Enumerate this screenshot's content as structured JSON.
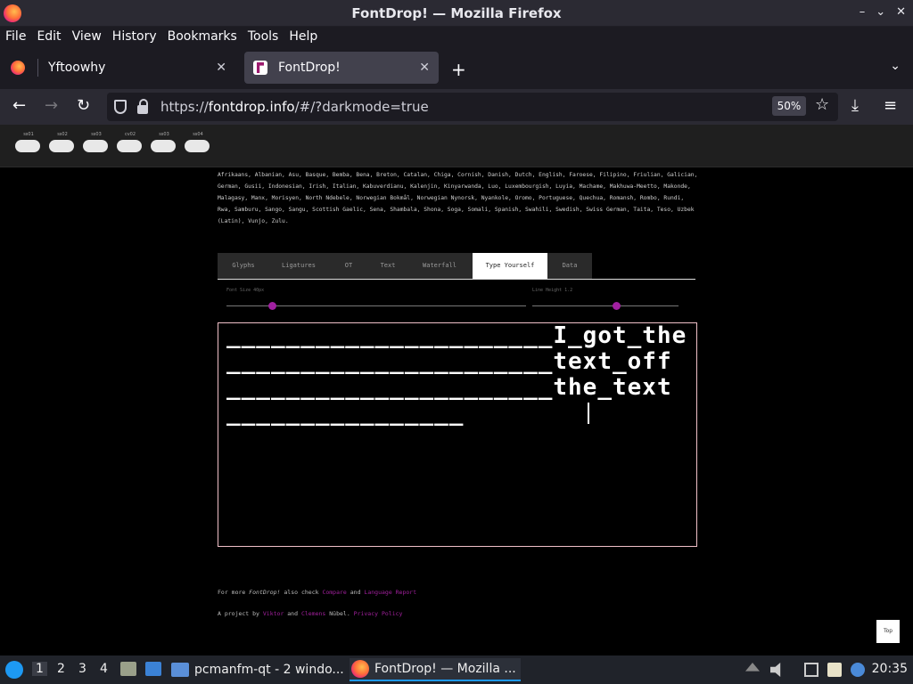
{
  "window": {
    "title": "FontDrop! — Mozilla Firefox",
    "controls": [
      "–",
      "⌄",
      "✕"
    ]
  },
  "menu": [
    "File",
    "Edit",
    "View",
    "History",
    "Bookmarks",
    "Tools",
    "Help"
  ],
  "tabs": [
    {
      "label": "Yftoowhy",
      "close": "✕"
    },
    {
      "label": "FontDrop!",
      "close": "✕"
    }
  ],
  "newtab": "+",
  "tablist": "⌄",
  "nav": {
    "back": "←",
    "forward": "→",
    "reload": "↻",
    "url_prefix": "https://",
    "url_domain": "fontdrop.info",
    "url_rest": "/#/?darkmode=true",
    "zoom": "50%",
    "star": "☆",
    "download": "⤓",
    "menu": "≡"
  },
  "toggles": [
    "ss01",
    "ss02",
    "ss03",
    "cv02",
    "ss03",
    "ss04"
  ],
  "languages": "Afrikaans, Albanian, Asu, Basque, Bemba, Bena, Breton, Catalan, Chiga, Cornish, Danish, Dutch, English, Faroese, Filipino, Friulian, Galician, German, Gusii, Indonesian, Irish, Italian, Kabuverdianu, Kalenjin, Kinyarwanda, Luo, Luxembourgish, Luyia, Machame, Makhuwa-Meetto, Makonde, Malagasy, Manx, Morisyen, North Ndebele, Norwegian Bokmål, Norwegian Nynorsk, Nyankole, Oromo, Portuguese, Quechua, Romansh, Rombo, Rundi, Rwa, Samburu, Sango, Sangu, Scottish Gaelic, Sena, Shambala, Shona, Soga, Somali, Spanish, Swahili, Swedish, Swiss German, Taita, Teso, Uzbek (Latin), Vunjo, Zulu.",
  "fd_tabs": [
    "Glyphs",
    "Ligatures",
    "OT",
    "Text",
    "Waterfall",
    "Type Yourself",
    "Data"
  ],
  "sliders": {
    "font_size_label": "Font Size 40px",
    "line_height_label": "Line Height 1.2"
  },
  "typed_lines": [
    "______________________I_got_the",
    "______________________text_off",
    "______________________the_text",
    "________________"
  ],
  "footer": {
    "line1_pre": "For more ",
    "line1_em": "FontDrop!",
    "line1_mid": " also check ",
    "link_compare": "Compare",
    "line1_and": " and ",
    "link_lang": "Language Report",
    "line2_pre": "A project by ",
    "link_viktor": "Viktor",
    "line2_and": " and ",
    "link_clemens": "Clemens",
    "line2_post": " Nübel. ",
    "link_privacy": "Privacy Policy"
  },
  "top_button": "Top",
  "taskbar": {
    "workspaces": [
      "1",
      "2",
      "3",
      "4"
    ],
    "task_files": "pcmanfm-qt - 2 windo...",
    "task_firefox": "FontDrop! — Mozilla ...",
    "clock": "20:35"
  },
  "colors": {
    "accent": "#a020a0",
    "taskbar_accent": "#1d99f3"
  }
}
